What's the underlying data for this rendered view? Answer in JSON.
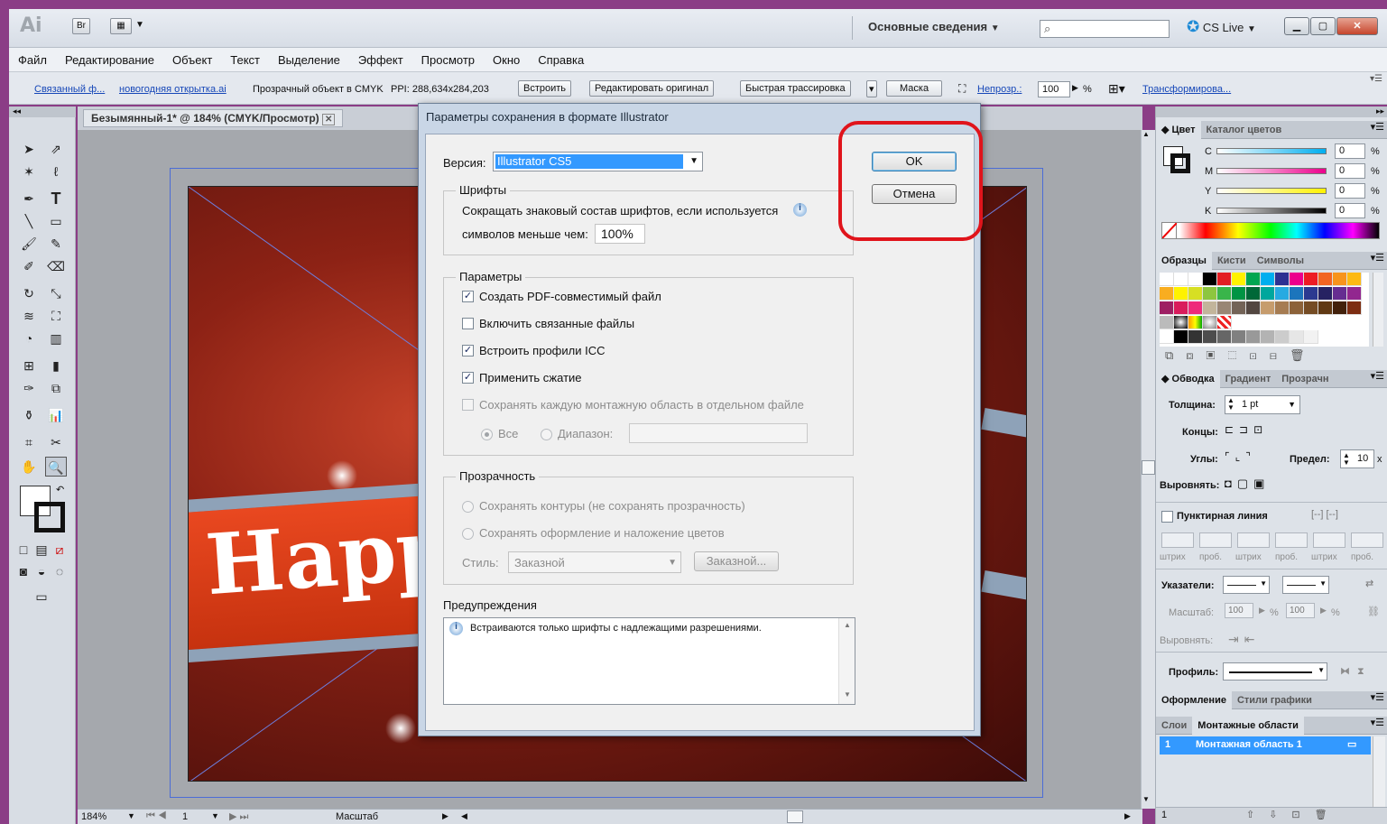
{
  "titlebar": {
    "app_logo": "Ai",
    "bridge_label": "Br",
    "workspace": "Основные сведения",
    "cslive": "CS Live"
  },
  "menu": [
    "Файл",
    "Редактирование",
    "Объект",
    "Текст",
    "Выделение",
    "Эффект",
    "Просмотр",
    "Окно",
    "Справка"
  ],
  "controlbar": {
    "linked_file": "Связанный ф...",
    "filename": "новогодняя открытка.ai",
    "object_info": "Прозрачный объект в CMYK",
    "ppi": "PPI: 288,634x284,203",
    "embed": "Встроить",
    "edit_original": "Редактировать оригинал",
    "live_trace": "Быстрая трассировка",
    "mask": "Маска",
    "opacity_label": "Непрозр.:",
    "opacity_value": "100",
    "percent": "%",
    "transform": "Трансформирова..."
  },
  "document": {
    "tab_label": "Безымянный-1* @ 184% (CMYK/Просмотр)",
    "banner_text": "Happ"
  },
  "status": {
    "zoom": "184%",
    "artboard": "1",
    "scale_label": "Масштаб"
  },
  "dialog": {
    "title": "Параметры сохранения в формате Illustrator",
    "version_label": "Версия:",
    "version_value": "Illustrator CS5",
    "ok": "OK",
    "cancel": "Отмена",
    "fonts_group": "Шрифты",
    "fonts_text1": "Сокращать знаковый состав шрифтов, если используется",
    "fonts_text2": "символов меньше чем:",
    "fonts_percent": "100%",
    "params_group": "Параметры",
    "opt_pdf": "Создать PDF-совместимый файл",
    "opt_linked": "Включить связанные файлы",
    "opt_icc": "Встроить профили ICC",
    "opt_compress": "Применить сжатие",
    "opt_artboards": "Сохранять каждую монтажную область в отдельном файле",
    "radio_all": "Все",
    "radio_range": "Диапазон:",
    "transparency_group": "Прозрачность",
    "tr_paths": "Сохранять контуры (не сохранять прозрачность)",
    "tr_appearance": "Сохранять оформление и наложение цветов",
    "style_label": "Стиль:",
    "style_value": "Заказной",
    "style_button": "Заказной...",
    "warnings_label": "Предупреждения",
    "warning_text": "Встраиваются только шрифты с надлежащими разрешениями."
  },
  "panels": {
    "color_tab": "Цвет",
    "color_catalog_tab": "Каталог цветов",
    "cmyk": [
      {
        "ch": "C",
        "value": "0"
      },
      {
        "ch": "M",
        "value": "0"
      },
      {
        "ch": "Y",
        "value": "0"
      },
      {
        "ch": "K",
        "value": "0"
      }
    ],
    "swatches_tab": "Образцы",
    "brushes_tab": "Кисти",
    "symbols_tab": "Символы",
    "stroke_tab": "Обводка",
    "gradient_tab": "Градиент",
    "transparency_tab": "Прозрачн",
    "weight_label": "Толщина:",
    "weight_value": "1 pt",
    "caps_label": "Концы:",
    "corners_label": "Углы:",
    "limit_label": "Предел:",
    "limit_value": "10",
    "limit_unit": "x",
    "align_label": "Выровнять:",
    "dashed_label": "Пунктирная линия",
    "dash_cols": [
      "штрих",
      "проб.",
      "штрих",
      "проб.",
      "штрих",
      "проб."
    ],
    "arrows_label": "Указатели:",
    "scale_label": "Масштаб:",
    "scale_v1": "100",
    "scale_v2": "100",
    "align2_label": "Выровнять:",
    "profile_label": "Профиль:",
    "appearance_tab": "Оформление",
    "graphic_styles_tab": "Стили графики",
    "layers_tab": "Слои",
    "artboards_tab": "Монтажные области",
    "artboard_row_num": "1",
    "artboard_row_name": "Монтажная область 1",
    "footer_count": "1"
  },
  "colors": {
    "accent_blue": "#3399ff",
    "highlight_red": "#e0141b",
    "dialog_title_bg": "#c9d6e6"
  }
}
